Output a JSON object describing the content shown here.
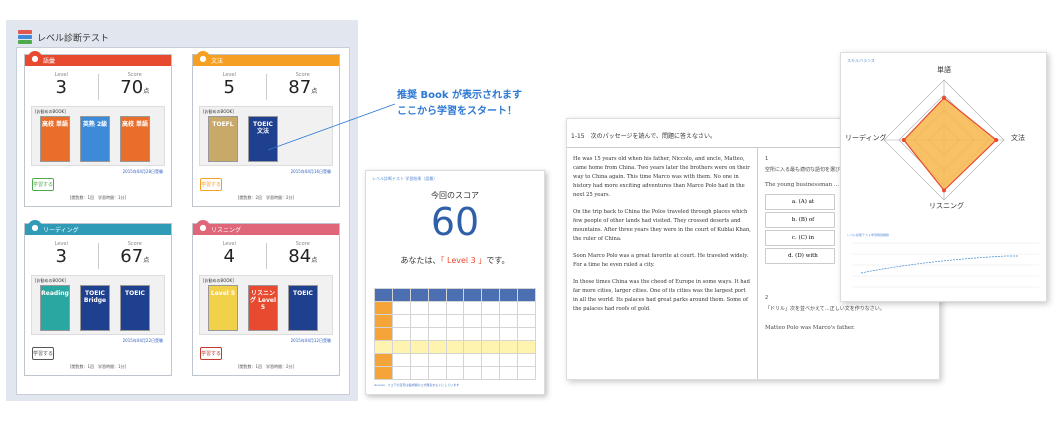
{
  "dashboard": {
    "title": "レベル診断テスト",
    "cards": [
      {
        "id": "vocab",
        "label": "語彙",
        "color": "#e84a2f",
        "button_color": "#4fa94d",
        "level_label": "Level",
        "level": "3",
        "score_label": "Score",
        "score": "70",
        "score_unit": "点",
        "rec_label": "[お勧めのBOOK]",
        "books": [
          {
            "title": "高校 単語",
            "color": "#e96d2b"
          },
          {
            "title": "英熟 2級",
            "color": "#3c8ad8"
          },
          {
            "title": "高校 単語",
            "color": "#e96d2b"
          }
        ],
        "date": "2015年04月28日受験",
        "button": "学習する",
        "footer": "[閲覧数：1回　学習時間：1分]"
      },
      {
        "id": "grammar",
        "label": "文法",
        "color": "#f5a022",
        "button_color": "#f5a022",
        "level_label": "Level",
        "level": "5",
        "score_label": "Score",
        "score": "87",
        "score_unit": "点",
        "rec_label": "[お勧めのBOOK]",
        "books": [
          {
            "title": "TOEFL",
            "color": "#c9a96a"
          },
          {
            "title": "TOEIC 文法",
            "color": "#1f3f8f"
          }
        ],
        "date": "2015年04月16日受験",
        "button": "学習する",
        "footer": "[閲覧数：2回　学習時間：2分]"
      },
      {
        "id": "reading",
        "label": "リーディング",
        "color": "#2f9bb7",
        "button_color": "#555555",
        "level_label": "Level",
        "level": "3",
        "score_label": "Score",
        "score": "67",
        "score_unit": "点",
        "rec_label": "[お勧めのBOOK]",
        "books": [
          {
            "title": "Reading",
            "color": "#2aa7a0"
          },
          {
            "title": "TOEIC Bridge",
            "color": "#1f3f8f"
          },
          {
            "title": "TOEIC",
            "color": "#1f3f8f"
          }
        ],
        "date": "2015年04月22日受験",
        "button": "学習する",
        "footer": "[閲覧数：1回　学習時間：1分]"
      },
      {
        "id": "listening",
        "label": "リスニング",
        "color": "#e0667a",
        "button_color": "#c0392b",
        "level_label": "Level",
        "level": "4",
        "score_label": "Score",
        "score": "84",
        "score_unit": "点",
        "rec_label": "[お勧めのBOOK]",
        "books": [
          {
            "title": "Level 5",
            "color": "#f2d14a"
          },
          {
            "title": "リスニング Level 5",
            "color": "#e84a2f"
          },
          {
            "title": "TOEIC",
            "color": "#1f3f8f"
          }
        ],
        "date": "2015年04月12日受験",
        "button": "学習する",
        "footer": "[閲覧数：1回　学習時間：2分]"
      }
    ]
  },
  "callout": {
    "line1": "推奨 Book が表示されます",
    "line2": "ここから学習をスタート！"
  },
  "report": {
    "header": "レベル診断テスト 学習結果（語彙）",
    "title": "今回のスコア",
    "score": "60",
    "prefix": "あなたは、",
    "level": "「 Level 3 」",
    "suffix": "です。",
    "note": "※Level、スコアの目安は各試験の公式発表をもとにしています"
  },
  "reading_test": {
    "question_header": "1-15　次のパッセージを読んで、問題に答えなさい。",
    "paragraphs": [
      "He was 15 years old when his father, Niccolo, and uncle, Matteo, came home from China. Two years later the brothers were on their way to China again. This time Marco was with them. No one in history had more exciting adventures than Marco Polo had in the next 25 years.",
      "On the trip back to China the Polos traveled through places which few people of other lands had visited. They crossed deserts and mountains. After three years they were in the court of Kublai Khan, the ruler of China.",
      "Soon Marco Polo was a great favorite at court. He traveled widely. For a time he even ruled a city.",
      "In those times China was the cheod of Europe in some ways. It had far more cities, larger cities. One of its cities was the largest port in all the world. Its palaces had great parks around them. Some of the palaces had roofs of gold."
    ],
    "q1_num": "1",
    "q1_text": "空所に入る最も適切な語句を選びなさい。",
    "q1_sentence": "The young businessman ... current salary.",
    "choices": [
      "a. (A) at",
      "b. (B) of",
      "c. (C) in",
      "d. (D) with"
    ],
    "q2_num": "2",
    "q2_text": "「ドリル」次を並べかえて…正しい文を作りなさい。",
    "answer": "Matteo Polo was Marco's father."
  },
  "skill": {
    "header": "スキルバランス",
    "axes": [
      "単語",
      "文法",
      "リスニング",
      "リーディング"
    ],
    "trend_title": "レベル診断テスト学習時間推移"
  },
  "chart_data": {
    "type": "radar",
    "categories": [
      "単語",
      "文法",
      "リスニング",
      "リーディング"
    ],
    "values": [
      70,
      87,
      84,
      67
    ],
    "range": [
      0,
      100
    ]
  }
}
